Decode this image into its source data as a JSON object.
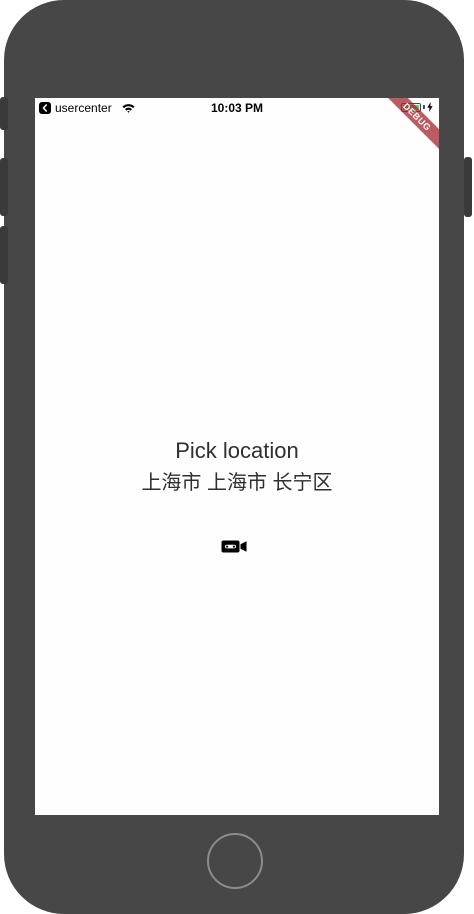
{
  "status_bar": {
    "back_app_label": "usercenter",
    "time": "10:03 PM",
    "battery_level": 1.0
  },
  "debug_banner": {
    "label": "DEBUG"
  },
  "main": {
    "title": "Pick location",
    "location": "上海市 上海市 长宁区"
  },
  "icons": {
    "back": "back-arrow-icon",
    "wifi": "wifi-icon",
    "battery": "battery-icon",
    "charging": "charging-icon",
    "camera": "video-camera-icon"
  },
  "colors": {
    "device_body": "#474747",
    "screen_bg": "#fefefe",
    "debug_banner": "#a6242c",
    "battery_fill": "#4cd964",
    "text": "#2f2f2f"
  }
}
